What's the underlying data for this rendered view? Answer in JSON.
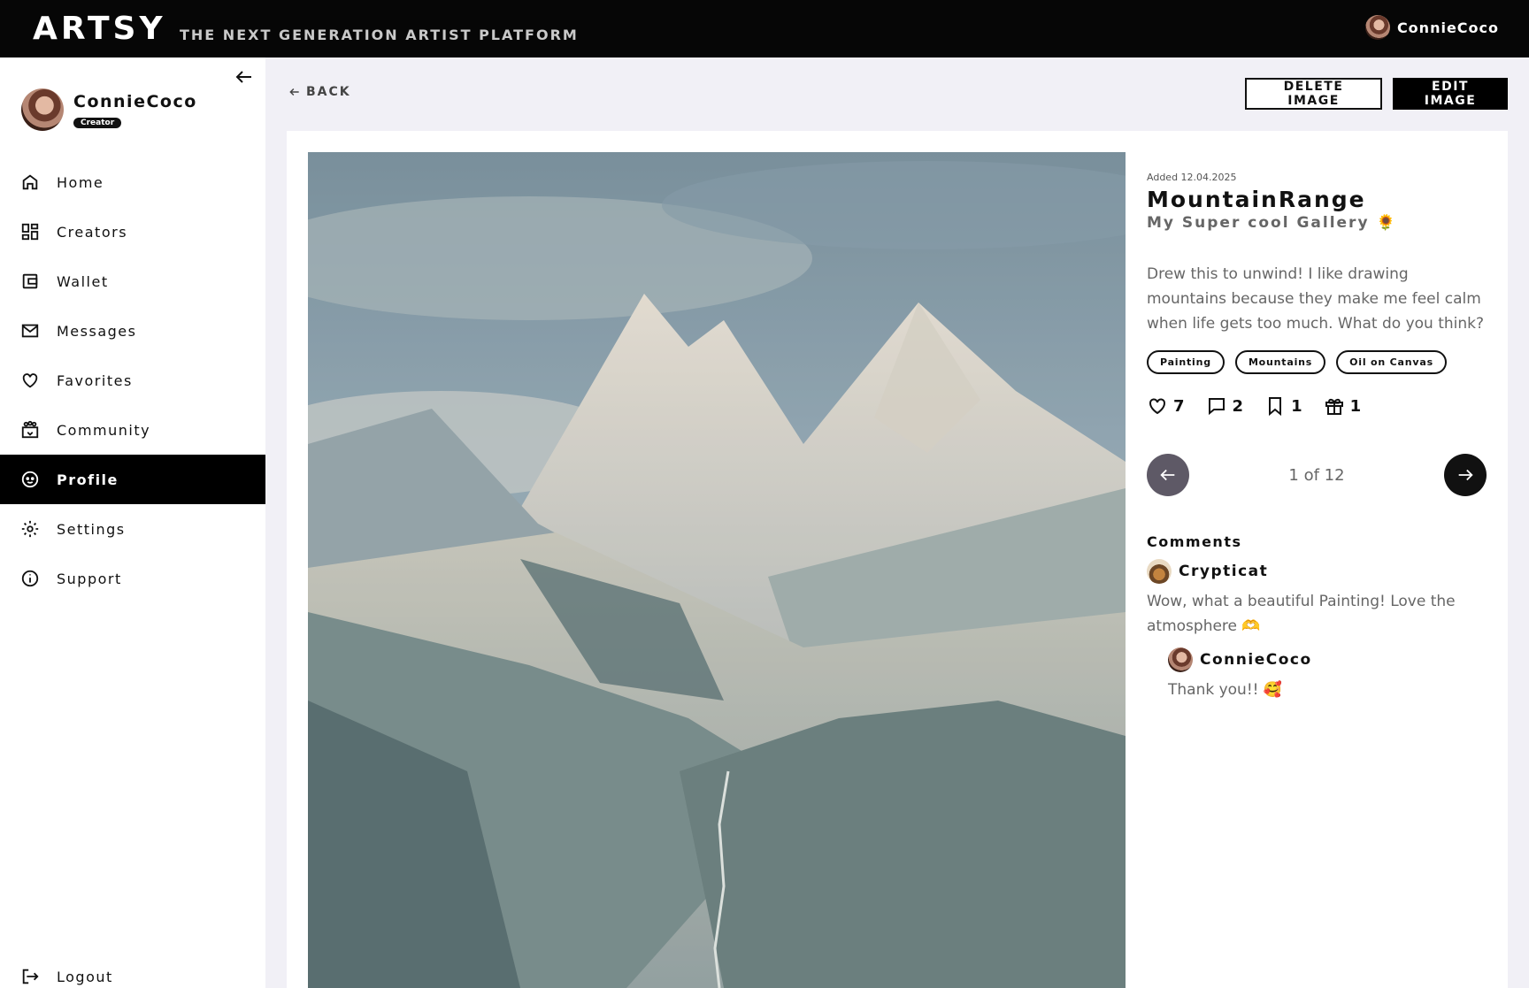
{
  "app": {
    "logo": "ARTSY",
    "tagline": "THE NEXT GENERATION ARTIST PLATFORM"
  },
  "topbar": {
    "username": "ConnieCoco"
  },
  "sidebar": {
    "username": "ConnieCoco",
    "role_badge": "Creator",
    "items": [
      {
        "label": "Home",
        "icon": "home-icon"
      },
      {
        "label": "Creators",
        "icon": "grid-icon"
      },
      {
        "label": "Wallet",
        "icon": "wallet-icon"
      },
      {
        "label": "Messages",
        "icon": "mail-icon"
      },
      {
        "label": "Favorites",
        "icon": "heart-icon"
      },
      {
        "label": "Community",
        "icon": "community-icon"
      },
      {
        "label": "Profile",
        "icon": "profile-icon",
        "active": true
      },
      {
        "label": "Settings",
        "icon": "gear-icon"
      },
      {
        "label": "Support",
        "icon": "info-icon"
      }
    ],
    "logout_label": "Logout"
  },
  "toolbar": {
    "back_label": "BACK",
    "delete_label": "DELETE IMAGE",
    "edit_label": "EDIT IMAGE"
  },
  "artwork": {
    "added": "Added 12.04.2025",
    "title": "MountainRange",
    "gallery": "My  Super cool Gallery 🌻",
    "description": "Drew this to unwind! I like drawing mountains because they make me feel calm when life gets too much. What do you think?",
    "tags": [
      "Painting",
      "Mountains",
      "Oil on Canvas"
    ],
    "stats": {
      "likes": "7",
      "comments": "2",
      "saves": "1",
      "gifts": "1"
    },
    "pager": "1 of 12"
  },
  "comments": {
    "heading": "Comments",
    "items": [
      {
        "author": "Crypticat",
        "text": "Wow, what a beautiful Painting! Love the atmosphere 🫶"
      },
      {
        "author": "ConnieCoco",
        "text": "Thank you!! 🥰"
      }
    ]
  },
  "colors": {
    "topbar": "#060606",
    "background": "#f1f0f6",
    "accent": "#000000",
    "muted_text": "#666666"
  }
}
